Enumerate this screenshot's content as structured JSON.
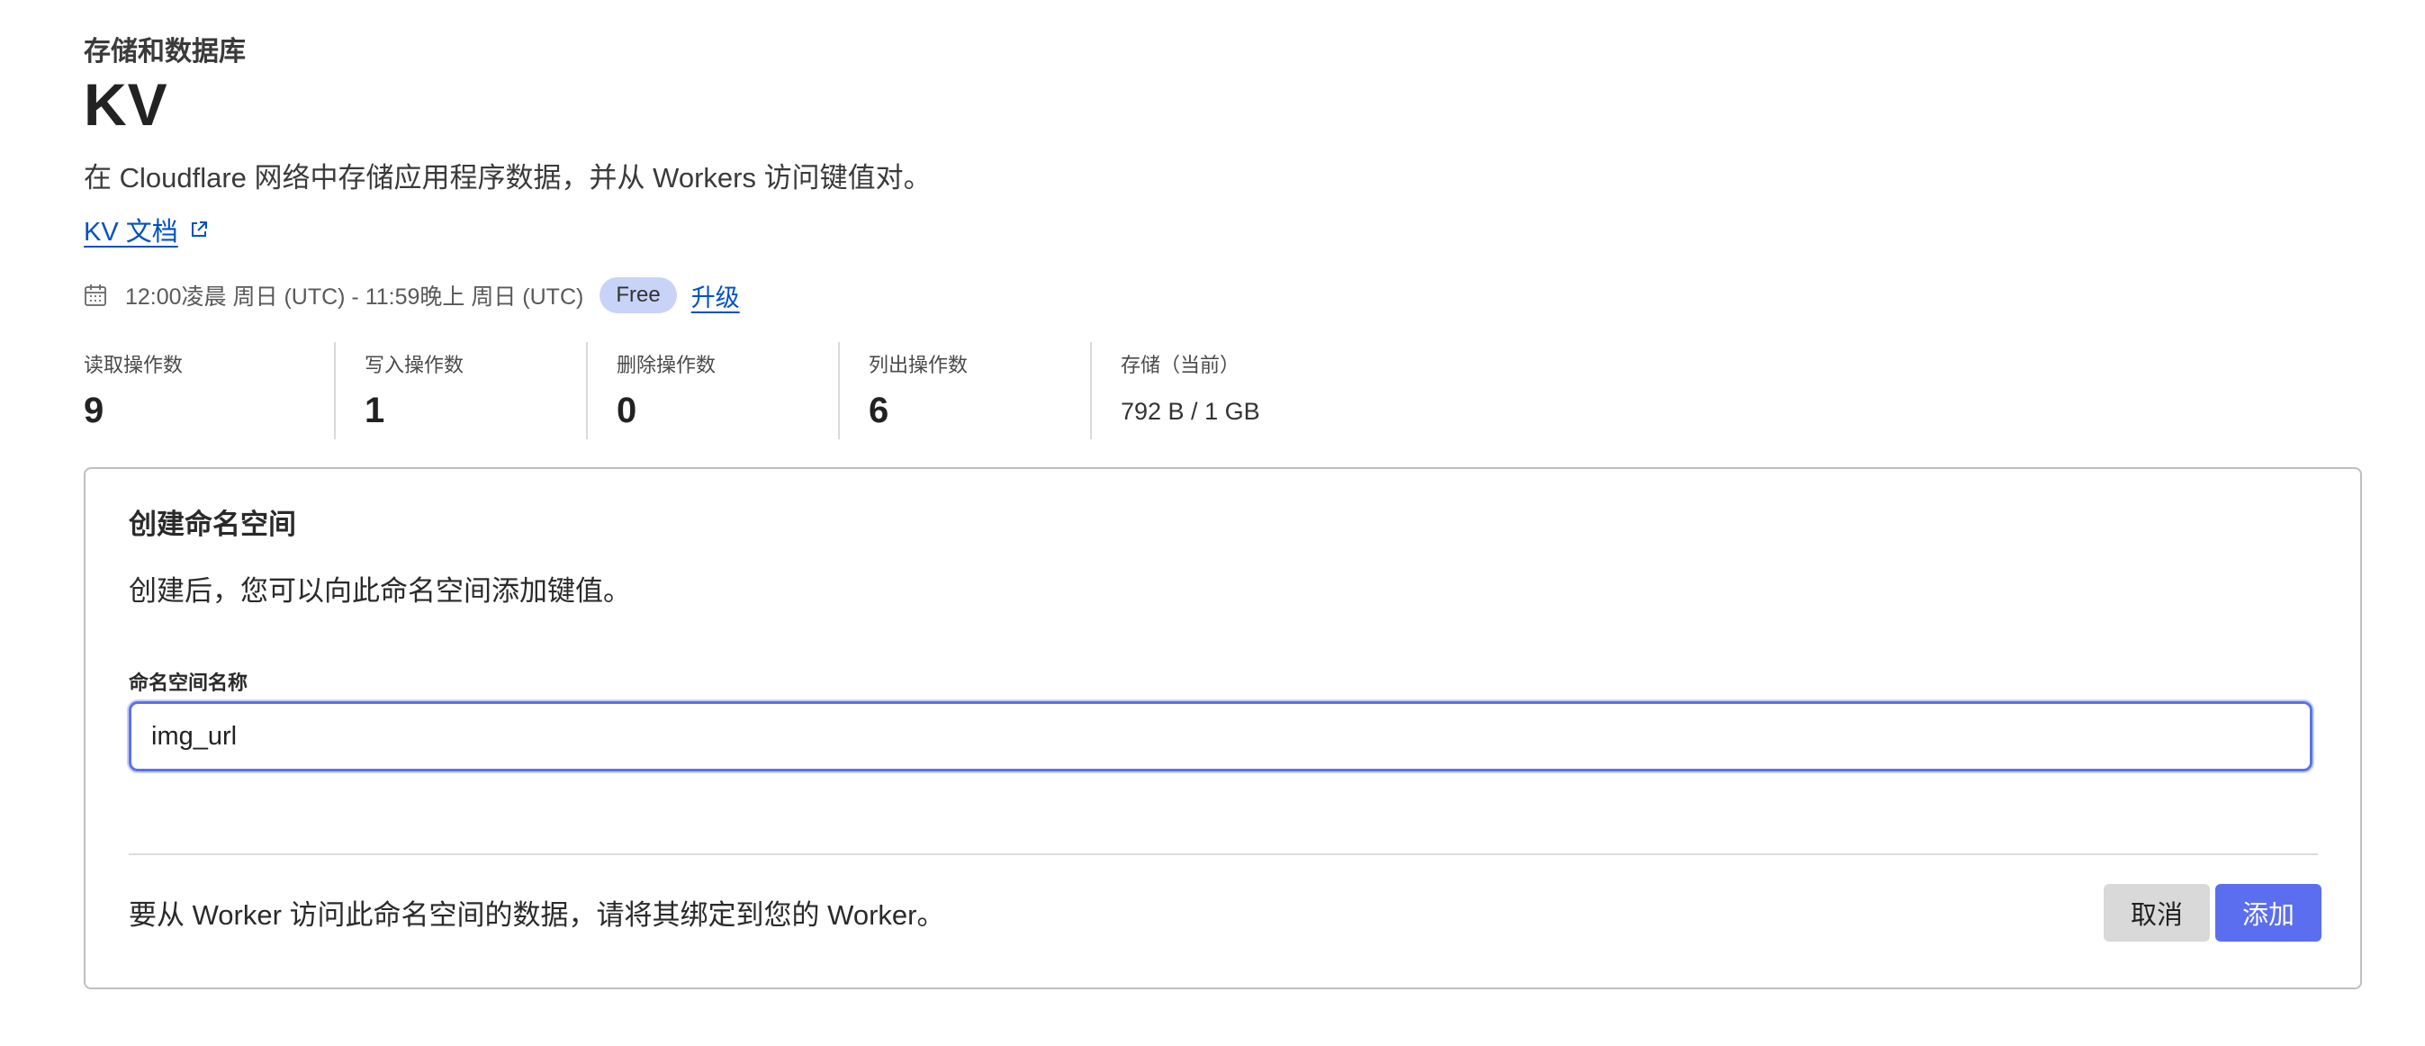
{
  "breadcrumb": "存储和数据库",
  "title": "KV",
  "description": "在 Cloudflare 网络中存储应用程序数据，并从 Workers 访问键值对。",
  "docs_link": "KV 文档",
  "period": {
    "range": "12:00凌晨 周日 (UTC) - 11:59晚上 周日 (UTC)",
    "plan_badge": "Free",
    "upgrade_label": "升级"
  },
  "stats": [
    {
      "label": "读取操作数",
      "value": "9"
    },
    {
      "label": "写入操作数",
      "value": "1"
    },
    {
      "label": "删除操作数",
      "value": "0"
    },
    {
      "label": "列出操作数",
      "value": "6"
    },
    {
      "label": "存储（当前）",
      "value": "792 B / 1 GB"
    }
  ],
  "create_card": {
    "title": "创建命名空间",
    "description": "创建后，您可以向此命名空间添加键值。",
    "field_label": "命名空间名称",
    "field_value": "img_url",
    "footer_text": "要从 Worker 访问此命名空间的数据，请将其绑定到您的 Worker。",
    "cancel_label": "取消",
    "add_label": "添加"
  },
  "colors": {
    "link": "#0051c3",
    "badge_bg": "#c8d3f8",
    "primary_button": "#5b6ef0",
    "focus_ring": "#5a72e8"
  }
}
